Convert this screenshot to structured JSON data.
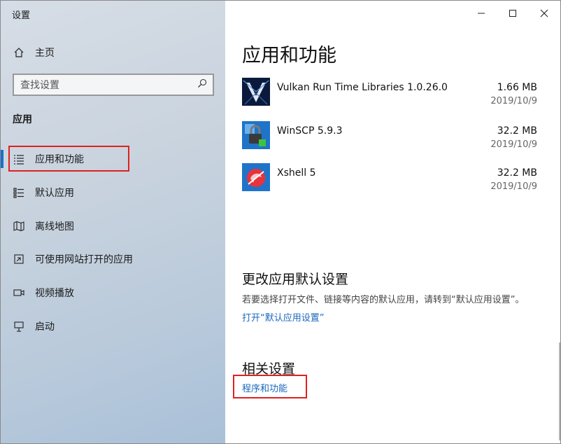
{
  "window": {
    "app_title": "设置",
    "controls": [
      "minimize",
      "maximize",
      "close"
    ]
  },
  "sidebar": {
    "home_label": "主页",
    "search_placeholder": "查找设置",
    "section_label": "应用",
    "items": [
      {
        "label": "应用和功能",
        "icon": "list-icon",
        "selected": true
      },
      {
        "label": "默认应用",
        "icon": "default-apps-icon",
        "selected": false
      },
      {
        "label": "离线地图",
        "icon": "map-icon",
        "selected": false
      },
      {
        "label": "可使用网站打开的应用",
        "icon": "open-website-icon",
        "selected": false
      },
      {
        "label": "视频播放",
        "icon": "video-icon",
        "selected": false
      },
      {
        "label": "启动",
        "icon": "startup-icon",
        "selected": false
      }
    ]
  },
  "main": {
    "title": "应用和功能",
    "apps": [
      {
        "name": "Vulkan Run Time Libraries 1.0.26.0",
        "size": "1.66 MB",
        "date": "2019/10/9",
        "icon": "vulkan-icon"
      },
      {
        "name": "WinSCP 5.9.3",
        "size": "32.2 MB",
        "date": "2019/10/9",
        "icon": "winscp-icon"
      },
      {
        "name": "Xshell 5",
        "size": "32.2 MB",
        "date": "2019/10/9",
        "icon": "xshell-icon"
      }
    ],
    "default_settings": {
      "heading": "更改应用默认设置",
      "description": "若要选择打开文件、链接等内容的默认应用，请转到“默认应用设置”。",
      "link": "打开“默认应用设置”"
    },
    "related": {
      "heading": "相关设置",
      "link": "程序和功能"
    }
  },
  "colors": {
    "accent": "#1a6fc9",
    "link": "#1a68bd",
    "highlight_box": "#e02020"
  }
}
